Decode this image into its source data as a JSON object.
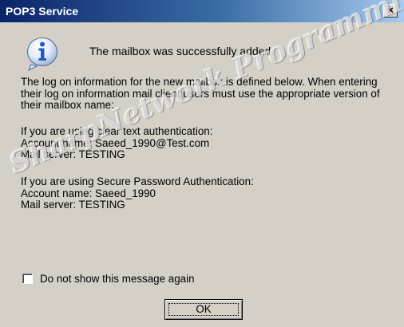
{
  "window": {
    "title": "POP3 Service",
    "close_label": "×"
  },
  "message": {
    "headline": "The mailbox was successfully added.",
    "icon": "info-icon",
    "paragraph1": [
      "The log on information for the new mailbox is defined below.  When entering",
      "their log on information mail client users must use the appropriate version of",
      "their mailbox name:"
    ],
    "paragraph2": [
      "If you are using clear text authentication:",
      "Account name: Saeed_1990@Test.com",
      "Mail server: TESTING"
    ],
    "paragraph3": [
      "If you are using Secure Password Authentication:",
      "Account name: Saeed_1990",
      "Mail server: TESTING"
    ]
  },
  "watermark": "SharpNetwork Programming",
  "checkbox": {
    "label": "Do not show this message again",
    "checked": false
  },
  "ok_button": {
    "label": "OK"
  },
  "colors": {
    "titlebar_start": "#0a246a",
    "titlebar_end": "#a6caf0",
    "window_bg": "#d4d0c8",
    "icon_blue": "#1e5bc6"
  }
}
